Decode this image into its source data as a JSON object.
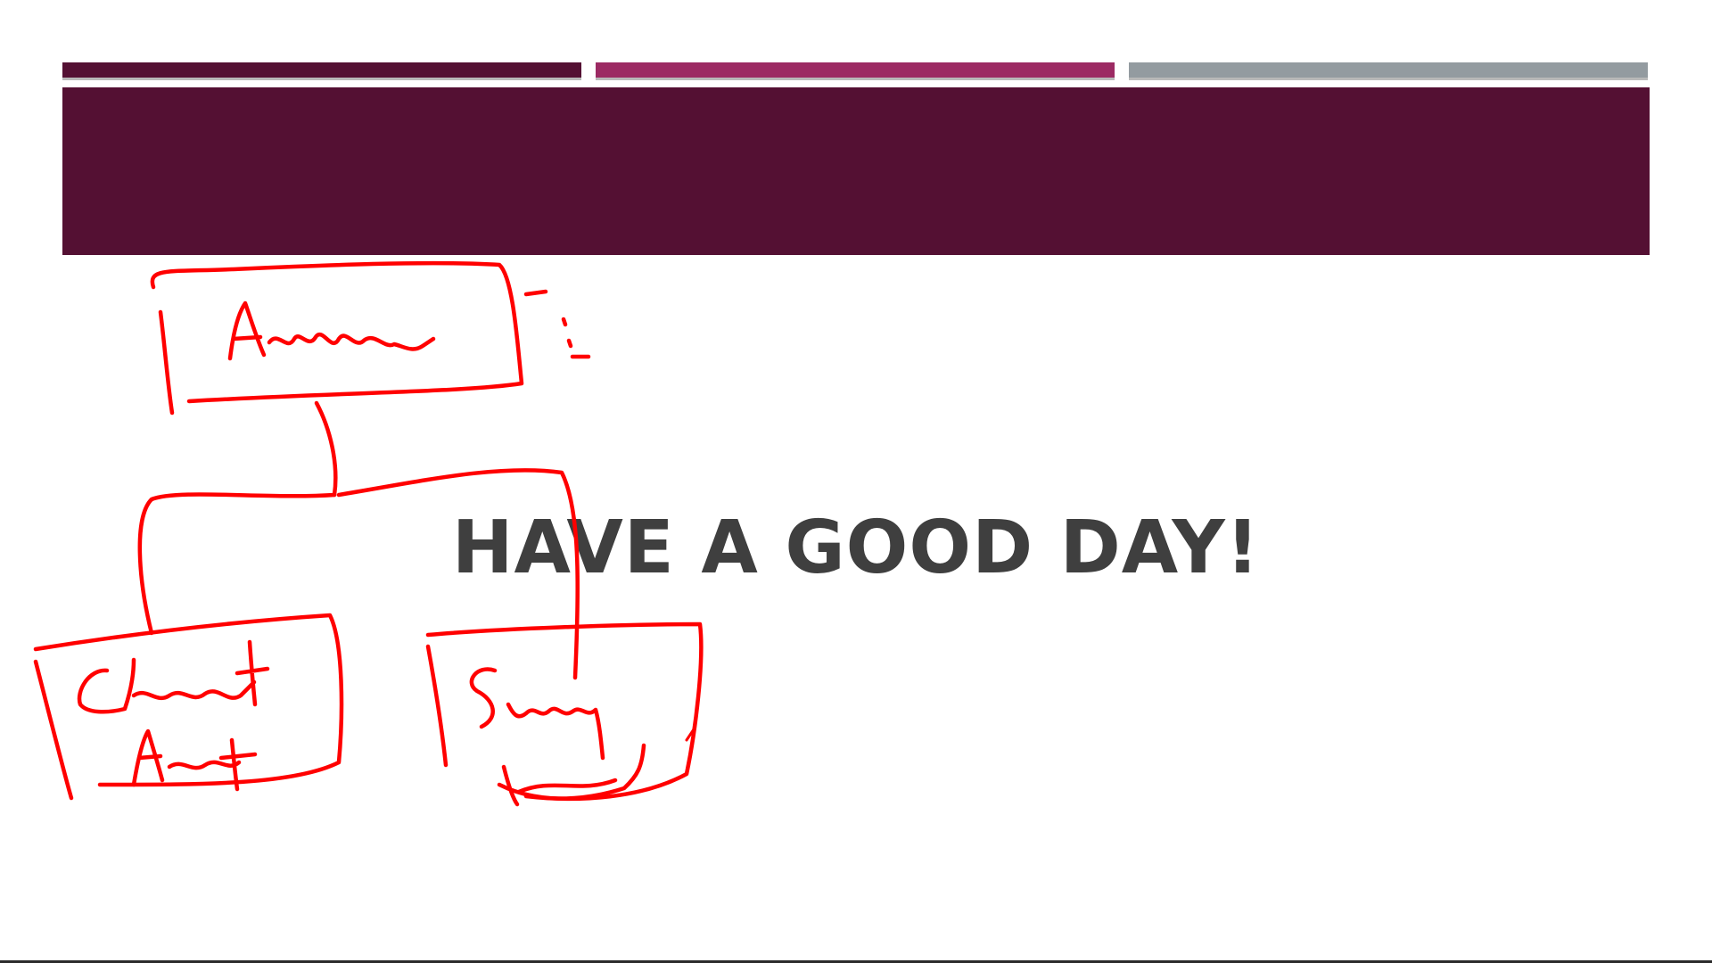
{
  "slide": {
    "heading": "HAVE A GOOD DAY!",
    "colors": {
      "background": "#ffffff",
      "title_band": "#541033",
      "bar_1": "#541033",
      "bar_2": "#9c2a63",
      "bar_3": "#939ba0",
      "heading_text": "#3f3f3f",
      "ink": "#ff0000"
    }
  },
  "annotation": {
    "type": "handwritten-hierarchy-sketch",
    "color": "#ff0000",
    "boxes": [
      "top-box",
      "left-box",
      "right-box"
    ]
  }
}
